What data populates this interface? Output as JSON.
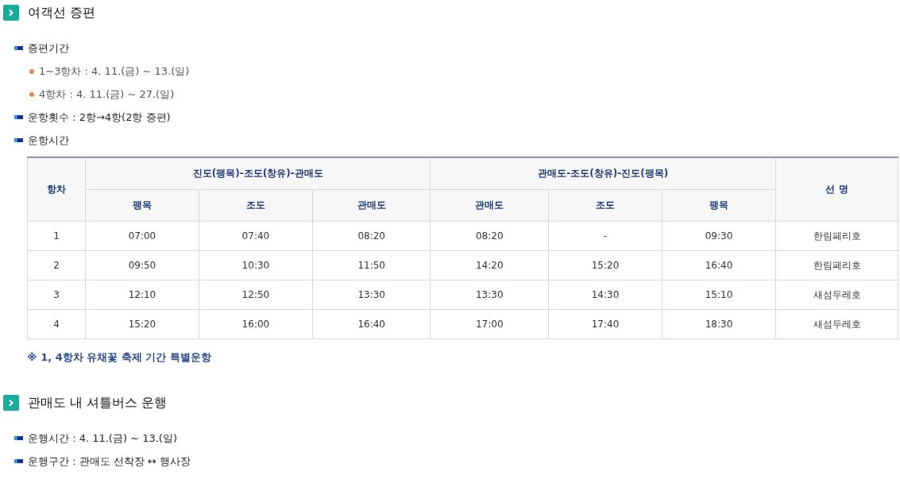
{
  "sections": [
    {
      "title": "여객선 증편",
      "items": [
        {
          "text": "증편기간",
          "children": [
            {
              "text": "1~3항차 : 4. 11.(금) ~ 13.(일)"
            },
            {
              "text": "4항차 : 4. 11.(금) ~ 27.(일)"
            }
          ]
        },
        {
          "text": "운항횟수 : 2항→4항(2항 증편)"
        },
        {
          "text": "운항시간"
        }
      ],
      "table": {
        "col_first": "항차",
        "groups": [
          "진도(팽목)-조도(창유)-관매도",
          "관매도-조도(창유)-진도(팽목)"
        ],
        "col_last": "선 명",
        "subcolumns": [
          "팽목",
          "조도",
          "관매도",
          "관매도",
          "조도",
          "팽목"
        ],
        "rows": [
          [
            "1",
            "07:00",
            "07:40",
            "08:20",
            "08:20",
            "-",
            "09:30",
            "한림페리호"
          ],
          [
            "2",
            "09:50",
            "10:30",
            "11:50",
            "14:20",
            "15:20",
            "16:40",
            "한림페리호"
          ],
          [
            "3",
            "12:10",
            "12:50",
            "13:30",
            "13:30",
            "14:30",
            "15:10",
            "새섬두레호"
          ],
          [
            "4",
            "15:20",
            "16:00",
            "16:40",
            "17:00",
            "17:40",
            "18:30",
            "새섬두레호"
          ]
        ]
      },
      "note": "※ 1, 4항차 유채꽃 축제 기간 특별운항"
    },
    {
      "title": "관매도 내 셔틀버스 운행",
      "items": [
        {
          "text": "운행시간 : 4. 11.(금) ~ 13.(일)"
        },
        {
          "text": "운행구간 : 관매도 선착장 ↔ 행사장"
        }
      ]
    }
  ]
}
